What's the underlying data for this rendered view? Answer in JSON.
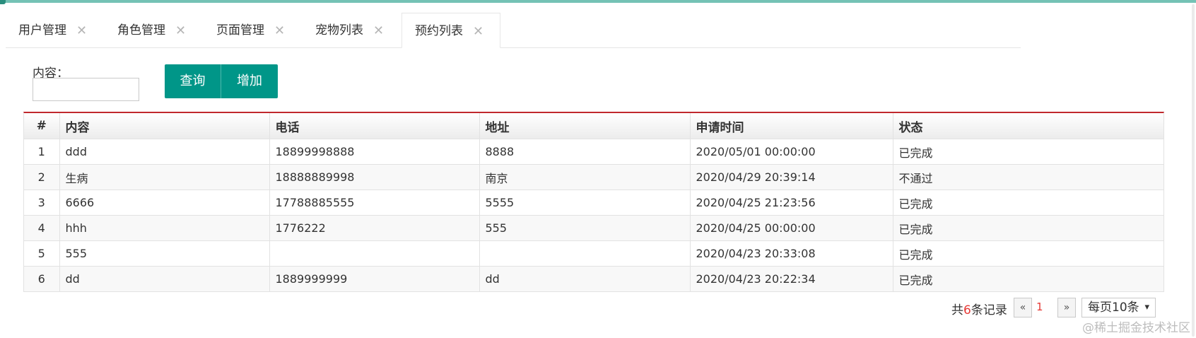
{
  "tabs": [
    {
      "label": "用户管理",
      "active": false
    },
    {
      "label": "角色管理",
      "active": false
    },
    {
      "label": "页面管理",
      "active": false
    },
    {
      "label": "宠物列表",
      "active": false
    },
    {
      "label": "预约列表",
      "active": true
    }
  ],
  "tab_close_glyph": "✕",
  "search": {
    "label": "内容：",
    "value": "",
    "placeholder": ""
  },
  "buttons": {
    "query": "查询",
    "add": "增加"
  },
  "table": {
    "columns": [
      "#",
      "内容",
      "电话",
      "地址",
      "申请时间",
      "状态"
    ],
    "rows": [
      [
        "1",
        "ddd",
        "18899998888",
        "8888",
        "2020/05/01 00:00:00",
        "已完成"
      ],
      [
        "2",
        "生病",
        "18888889998",
        "南京",
        "2020/04/29 20:39:14",
        "不通过"
      ],
      [
        "3",
        "6666",
        "17788885555",
        "5555",
        "2020/04/25 21:23:56",
        "已完成"
      ],
      [
        "4",
        "hhh",
        "1776222",
        "555",
        "2020/04/25 00:00:00",
        "已完成"
      ],
      [
        "5",
        "555",
        "",
        "",
        "2020/04/23 20:33:08",
        "已完成"
      ],
      [
        "6",
        "dd",
        "1889999999",
        "dd",
        "2020/04/23 20:22:34",
        "已完成"
      ]
    ]
  },
  "pager": {
    "total_prefix": "共",
    "total_count": "6",
    "total_suffix": "条记录",
    "prev_glyph": "«",
    "current_page": "1",
    "next_glyph": "»",
    "page_size_label": "每页10条"
  },
  "watermark": "@稀土掘金技术社区",
  "colors": {
    "primary": "#009688",
    "accent_line": "#c0282d",
    "top_bar": "#74c2b5",
    "pager_highlight": "#e53935"
  }
}
